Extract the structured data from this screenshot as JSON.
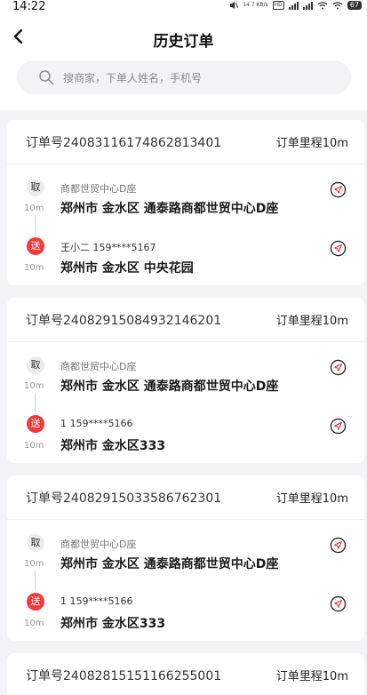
{
  "status": {
    "time": "14:22",
    "speed": "14.7 KB/s",
    "battery": "67"
  },
  "header": {
    "title": "历史订单"
  },
  "search": {
    "placeholder": "搜商家，下单人姓名，手机号"
  },
  "colors": {
    "accent": "#f23a3a",
    "background": "#f4f4f6"
  },
  "orders": [
    {
      "order_no": "订单号24083116174862813401",
      "mileage": "订单里程10m",
      "pickup": {
        "tag": "取",
        "distance": "10m",
        "name": "商都世贸中心D座",
        "address": "郑州市 金水区 通泰路商都世贸中心D座"
      },
      "dropoff": {
        "tag": "送",
        "distance": "10m",
        "contact": "王小二 159****5167",
        "address": "郑州市 金水区 中央花园"
      }
    },
    {
      "order_no": "订单号24082915084932146201",
      "mileage": "订单里程10m",
      "pickup": {
        "tag": "取",
        "distance": "10m",
        "name": "商都世贸中心D座",
        "address": "郑州市 金水区 通泰路商都世贸中心D座"
      },
      "dropoff": {
        "tag": "送",
        "distance": "10m",
        "contact": "1 159****5166",
        "address": "郑州市 金水区333"
      }
    },
    {
      "order_no": "订单号24082915033586762301",
      "mileage": "订单里程10m",
      "pickup": {
        "tag": "取",
        "distance": "10m",
        "name": "商都世贸中心D座",
        "address": "郑州市 金水区 通泰路商都世贸中心D座"
      },
      "dropoff": {
        "tag": "送",
        "distance": "10m",
        "contact": "1 159****5166",
        "address": "郑州市 金水区333"
      }
    },
    {
      "order_no": "订单号24082815151166255001",
      "mileage": "订单里程10m"
    }
  ]
}
